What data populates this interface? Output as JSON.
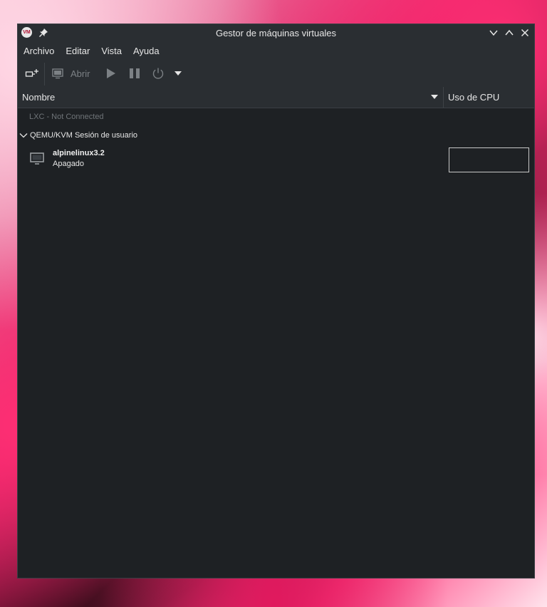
{
  "window": {
    "title": "Gestor de máquinas virtuales",
    "app_icon_text": "VM"
  },
  "menubar": {
    "items": [
      "Archivo",
      "Editar",
      "Vista",
      "Ayuda"
    ]
  },
  "toolbar": {
    "open_label": "Abrir"
  },
  "columns": {
    "name": "Nombre",
    "cpu": "Uso de CPU"
  },
  "connections": [
    {
      "label": "LXC - Not Connected",
      "expanded": false,
      "connected": false
    },
    {
      "label": "QEMU/KVM Sesión de usuario",
      "expanded": true,
      "connected": true,
      "vms": [
        {
          "name": "alpinelinux3.2",
          "state": "Apagado",
          "icon": "monitor-icon"
        }
      ]
    }
  ],
  "colors": {
    "background": "#1e2124",
    "panel": "#2a2e32",
    "text": "#e6e6e6",
    "disabled_text": "#6f7478"
  }
}
